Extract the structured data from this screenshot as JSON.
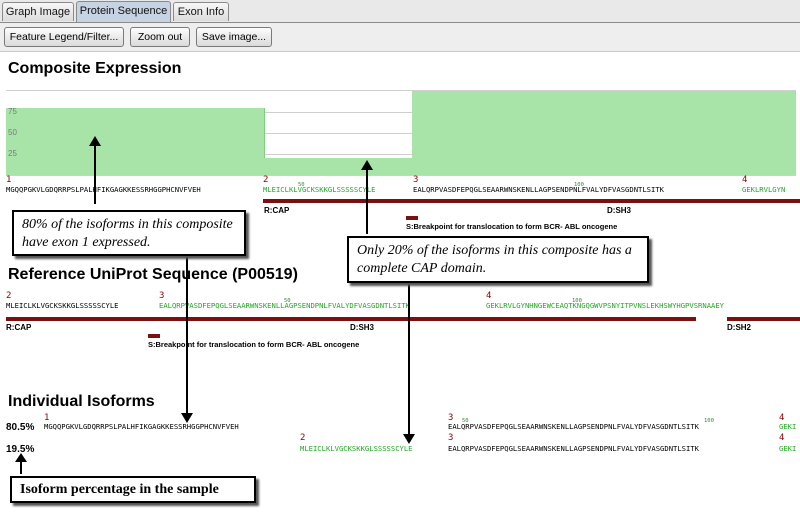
{
  "tabs": [
    {
      "label": "Graph Image"
    },
    {
      "label": "Protein Sequence"
    },
    {
      "label": "Exon Info"
    }
  ],
  "toolbar": {
    "feature_legend": "Feature Legend/Filter...",
    "zoom_out": "Zoom out",
    "save_image": "Save image..."
  },
  "composite": {
    "title": "Composite Expression",
    "y_ticks": [
      "75",
      "50",
      "25"
    ],
    "exon_numbers": [
      "1",
      "2",
      "3",
      "4"
    ],
    "tick_50": "50",
    "tick_100": "100",
    "seq_exon1": "MGQQPGKVLGDQRRPSLPALHFIKGAGKKESSRHGGPHCNVFVEH",
    "seq_exon2": "MLEICLKLVGCKSKKGLSSSSSCYLE",
    "seq_exon3": "EALQRPVASDFEPQGLSEAARWNSKENLLAGPSENDPNLFVALYDFVASGDNTLSITK",
    "seq_exon4": "GEKLRVLGYN",
    "feature_cap": "R:CAP",
    "feature_sh3": "D:SH3",
    "breakpoint": "S:Breakpoint for translocation to form BCR- ABL oncogene"
  },
  "reference": {
    "title": "Reference UniProt Sequence (P00519)",
    "exon_numbers": [
      "2",
      "3",
      "4"
    ],
    "tick_50": "50",
    "tick_100": "100",
    "seq_exon2": "MLEICLKLVGCKSKKGLSSSSSCYLE",
    "seq_exon3": "EALQRPVASDFEPQGLSEAARWNSKENLLAGPSENDPNLFVALYDFVASGDNTLSITK",
    "seq_exon4": "GEKLRVLGYNHNGEWCEAQTKNGQGWVPSNYITPVNSLEKHSWYHGPVSRNAAEY",
    "feature_cap": "R:CAP",
    "feature_sh3": "D:SH3",
    "feature_sh2": "D:SH2",
    "breakpoint": "S:Breakpoint for translocation to form BCR- ABL oncogene"
  },
  "isoforms": {
    "title": "Individual Isoforms",
    "rows": [
      {
        "percent": "80.5%",
        "exon_a": "1",
        "seq_a": "MGQQPGKVLGDQRRPSLPALHFIKGAGKKESSRHGGPHCNVFVEH",
        "exon_b": "3",
        "seq_b": "EALQRPVASDFEPQGLSEAARWNSKENLLAGPSENDPNLFVALYDFVASGDNTLSITK",
        "exon_c": "4",
        "seq_c": "GEKI"
      },
      {
        "percent": "19.5%",
        "exon_a": "2",
        "seq_a": "MLEICLKLVGCKSKKGLSSSSSCYLE",
        "exon_b": "3",
        "seq_b": "EALQRPVASDFEPQGLSEAARWNSKENLLAGPSENDPNLFVALYDFVASGDNTLSITK",
        "exon_c": "4",
        "seq_c": "GEKI"
      }
    ],
    "tick_50": "50",
    "tick_100": "100"
  },
  "callouts": {
    "c1": "80% of the isoforms in this composite have exon 1 expressed.",
    "c2": "Only 20% of the isoforms in this composite has a complete CAP domain.",
    "c3": "Isoform percentage in the sample"
  },
  "chart_data": {
    "type": "area",
    "title": "Composite Expression",
    "ylim": [
      0,
      100
    ],
    "yticks": [
      25,
      50,
      75
    ],
    "segments": [
      {
        "exon": "1",
        "value": 80
      },
      {
        "exon": "2",
        "value": 20
      },
      {
        "exon": "3",
        "value": 100
      },
      {
        "exon": "4",
        "value": 100
      }
    ],
    "fill_color": "#a8e4a8",
    "grid": true
  }
}
